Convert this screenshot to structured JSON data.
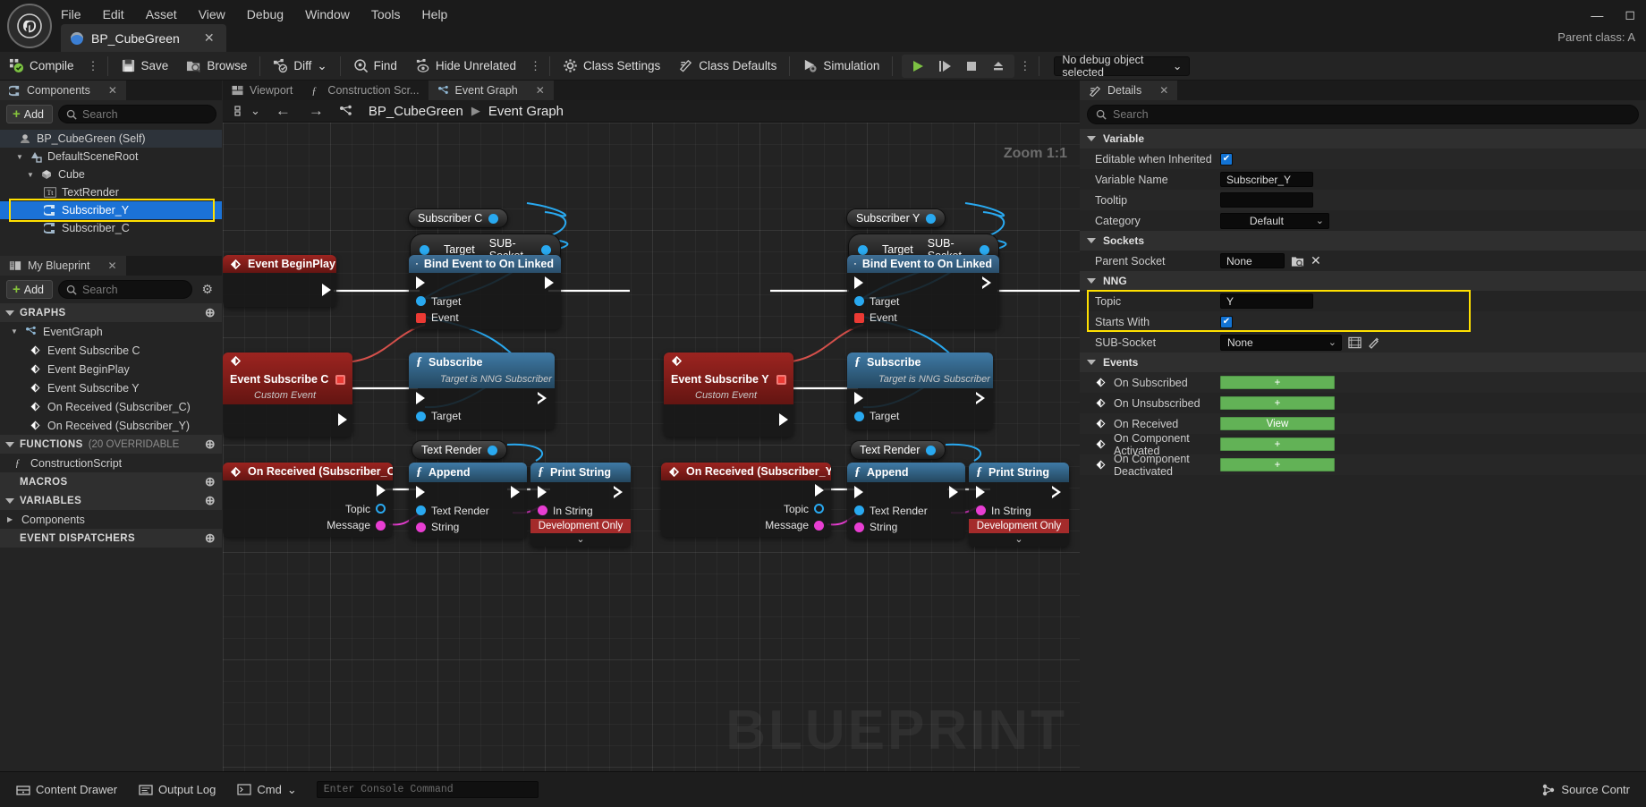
{
  "titlebar": {
    "menus": [
      "File",
      "Edit",
      "Asset",
      "View",
      "Debug",
      "Window",
      "Tools",
      "Help"
    ],
    "tab_label": "BP_CubeGreen",
    "tab_close": "✕",
    "minimize": "—",
    "maximize": "◻",
    "parent_class": "Parent class: A"
  },
  "toolbar": {
    "compile": "Compile",
    "kebab": "⋮",
    "save": "Save",
    "browse": "Browse",
    "diff": "Diff",
    "diff_caret": "⌄",
    "find": "Find",
    "hide_unrelated": "Hide Unrelated",
    "class_settings": "Class Settings",
    "class_defaults": "Class Defaults",
    "simulation": "Simulation",
    "debug_object": "No debug object selected",
    "debug_caret": "⌄"
  },
  "components": {
    "tab_label": "Components",
    "tab_close": "✕",
    "add_label": "Add",
    "search_placeholder": "Search",
    "tree": [
      {
        "label": "BP_CubeGreen (Self)",
        "depth": 0,
        "icon": "self-icon",
        "arrow": "",
        "state": "header"
      },
      {
        "label": "DefaultSceneRoot",
        "depth": 1,
        "icon": "scene-root-icon",
        "arrow": "▼",
        "state": ""
      },
      {
        "label": "Cube",
        "depth": 2,
        "icon": "mesh-icon",
        "arrow": "▼",
        "state": ""
      },
      {
        "label": "TextRender",
        "depth": 3,
        "icon": "text-render-icon",
        "arrow": "",
        "state": ""
      },
      {
        "label": "Subscriber_Y",
        "depth": 3,
        "icon": "component-icon",
        "arrow": "",
        "state": "selected"
      },
      {
        "label": "Subscriber_C",
        "depth": 3,
        "icon": "component-icon",
        "arrow": "",
        "state": ""
      }
    ]
  },
  "myblueprint": {
    "tab_label": "My Blueprint",
    "tab_close": "✕",
    "add_label": "Add",
    "search_placeholder": "Search",
    "gear": "⚙",
    "sections": [
      {
        "title": "GRAPHS",
        "count": "",
        "add": "⊕",
        "items": [
          {
            "label": "EventGraph",
            "icon": "graph-icon",
            "arrow": "▼",
            "depth": 0
          },
          {
            "label": "Event Subscribe C",
            "icon": "event-icon",
            "arrow": "",
            "depth": 1
          },
          {
            "label": "Event BeginPlay",
            "icon": "event-icon",
            "arrow": "",
            "depth": 1
          },
          {
            "label": "Event Subscribe Y",
            "icon": "event-icon",
            "arrow": "",
            "depth": 1
          },
          {
            "label": "On Received (Subscriber_C)",
            "icon": "event-icon",
            "arrow": "",
            "depth": 1
          },
          {
            "label": "On Received (Subscriber_Y)",
            "icon": "event-icon",
            "arrow": "",
            "depth": 1
          }
        ]
      },
      {
        "title": "FUNCTIONS",
        "count": "(20 OVERRIDABLE",
        "add": "⊕",
        "items": [
          {
            "label": "ConstructionScript",
            "icon": "function-icon",
            "arrow": "",
            "depth": 0
          }
        ]
      },
      {
        "title": "MACROS",
        "count": "",
        "add": "⊕",
        "items": []
      },
      {
        "title": "VARIABLES",
        "count": "",
        "add": "⊕",
        "items": [
          {
            "label": "Components",
            "icon": "",
            "arrow": "▶",
            "depth": 0
          }
        ]
      },
      {
        "title": "EVENT DISPATCHERS",
        "count": "",
        "add": "⊕",
        "items": []
      }
    ]
  },
  "graph": {
    "tabs": [
      {
        "label": "Viewport",
        "icon": "viewport-icon",
        "active": false,
        "close": ""
      },
      {
        "label": "Construction Scr...",
        "icon": "function-icon",
        "active": false,
        "close": ""
      },
      {
        "label": "Event Graph",
        "icon": "graph-icon",
        "active": true,
        "close": "✕"
      }
    ],
    "nav_caret": "⌄",
    "back": "←",
    "forward": "→",
    "home": "⊞",
    "breadcrumb_root": "BP_CubeGreen",
    "breadcrumb_sep": "▶",
    "breadcrumb_leaf": "Event Graph",
    "zoom": "Zoom 1:1",
    "watermark": "BLUEPRINT",
    "nodes": {
      "event_beginplay": {
        "title": "Event BeginPlay"
      },
      "event_subscribe_c": {
        "title": "Event Subscribe C",
        "subtitle": "Custom Event"
      },
      "event_subscribe_y": {
        "title": "Event Subscribe Y",
        "subtitle": "Custom Event"
      },
      "on_received_c": {
        "title": "On Received (Subscriber_C)"
      },
      "on_received_y": {
        "title": "On Received (Subscriber_Y)"
      },
      "var_subscriber_c": {
        "title": "Subscriber C"
      },
      "var_subscriber_y": {
        "title": "Subscriber Y"
      },
      "socket_c": {
        "left": "Target",
        "right": "SUB-Socket"
      },
      "socket_y": {
        "left": "Target",
        "right": "SUB-Socket"
      },
      "bind_c": {
        "title": "Bind Event to On Linked",
        "pin_target": "Target",
        "pin_event": "Event"
      },
      "bind_y": {
        "title": "Bind Event to On Linked",
        "pin_target": "Target",
        "pin_event": "Event"
      },
      "subscribe_c": {
        "title": "Subscribe",
        "subtitle": "Target is NNG Subscriber",
        "pin_target": "Target"
      },
      "subscribe_y": {
        "title": "Subscribe",
        "subtitle": "Target is NNG Subscriber",
        "pin_target": "Target"
      },
      "textrender_c": {
        "title": "Text Render"
      },
      "textrender_y": {
        "title": "Text Render"
      },
      "append_c": {
        "title": "Append",
        "pin_a": "Text Render",
        "pin_b": "String"
      },
      "append_y": {
        "title": "Append",
        "pin_a": "Text Render",
        "pin_b": "String"
      },
      "print_c": {
        "title": "Print String",
        "pin_in": "In String",
        "dev_only": "Development Only",
        "chev": "⌄"
      },
      "print_y": {
        "title": "Print String",
        "pin_in": "In String",
        "dev_only": "Development Only",
        "chev": "⌄"
      },
      "recv_c_topic": "Topic",
      "recv_c_message": "Message",
      "recv_y_topic": "Topic",
      "recv_y_message": "Message"
    }
  },
  "details": {
    "tab_label": "Details",
    "tab_close": "✕",
    "search_placeholder": "Search",
    "sections": [
      {
        "title": "Variable",
        "rows": [
          {
            "label": "Editable when Inherited",
            "type": "checkbox",
            "value": "✔",
            "checked": true
          },
          {
            "label": "Variable Name",
            "type": "text",
            "value": "Subscriber_Y"
          },
          {
            "label": "Tooltip",
            "type": "text",
            "value": ""
          },
          {
            "label": "Category",
            "type": "combo",
            "value": "Default",
            "caret": "⌄"
          }
        ]
      },
      {
        "title": "Sockets",
        "rows": [
          {
            "label": "Parent Socket",
            "type": "socket",
            "value": "None",
            "browse": "browse-icon",
            "clear": "✕"
          }
        ]
      },
      {
        "title": "NNG",
        "rows": [
          {
            "label": "Topic",
            "type": "text",
            "value": "Y"
          },
          {
            "label": "Starts With",
            "type": "checkbox",
            "value": "✔",
            "checked": true
          },
          {
            "label": "SUB-Socket",
            "type": "combo-wide",
            "value": "None",
            "caret": "⌄",
            "extra1": "picker-icon",
            "extra2": "edit-icon"
          }
        ]
      }
    ],
    "events_section": {
      "title": "Events",
      "rows": [
        {
          "label": "On Subscribed",
          "button": "+"
        },
        {
          "label": "On Unsubscribed",
          "button": "+"
        },
        {
          "label": "On Received",
          "button": "View"
        },
        {
          "label": "On Component Activated",
          "button": "+"
        },
        {
          "label": "On Component Deactivated",
          "button": "+"
        }
      ]
    }
  },
  "statusbar": {
    "content_drawer": "Content Drawer",
    "output_log": "Output Log",
    "cmd": "Cmd",
    "cmd_caret": "⌄",
    "console_placeholder": "Enter Console Command",
    "source_control": "Source Contr"
  },
  "colors": {
    "accent_blue": "#1b72d6",
    "highlight_yellow": "#ffe000",
    "event_red": "#9c2420",
    "function_blue": "#3f7aa6",
    "green_button": "#62b256",
    "pin_blue": "#29a9f0",
    "pin_pink": "#e83ed2",
    "pin_red": "#ec3a34"
  }
}
